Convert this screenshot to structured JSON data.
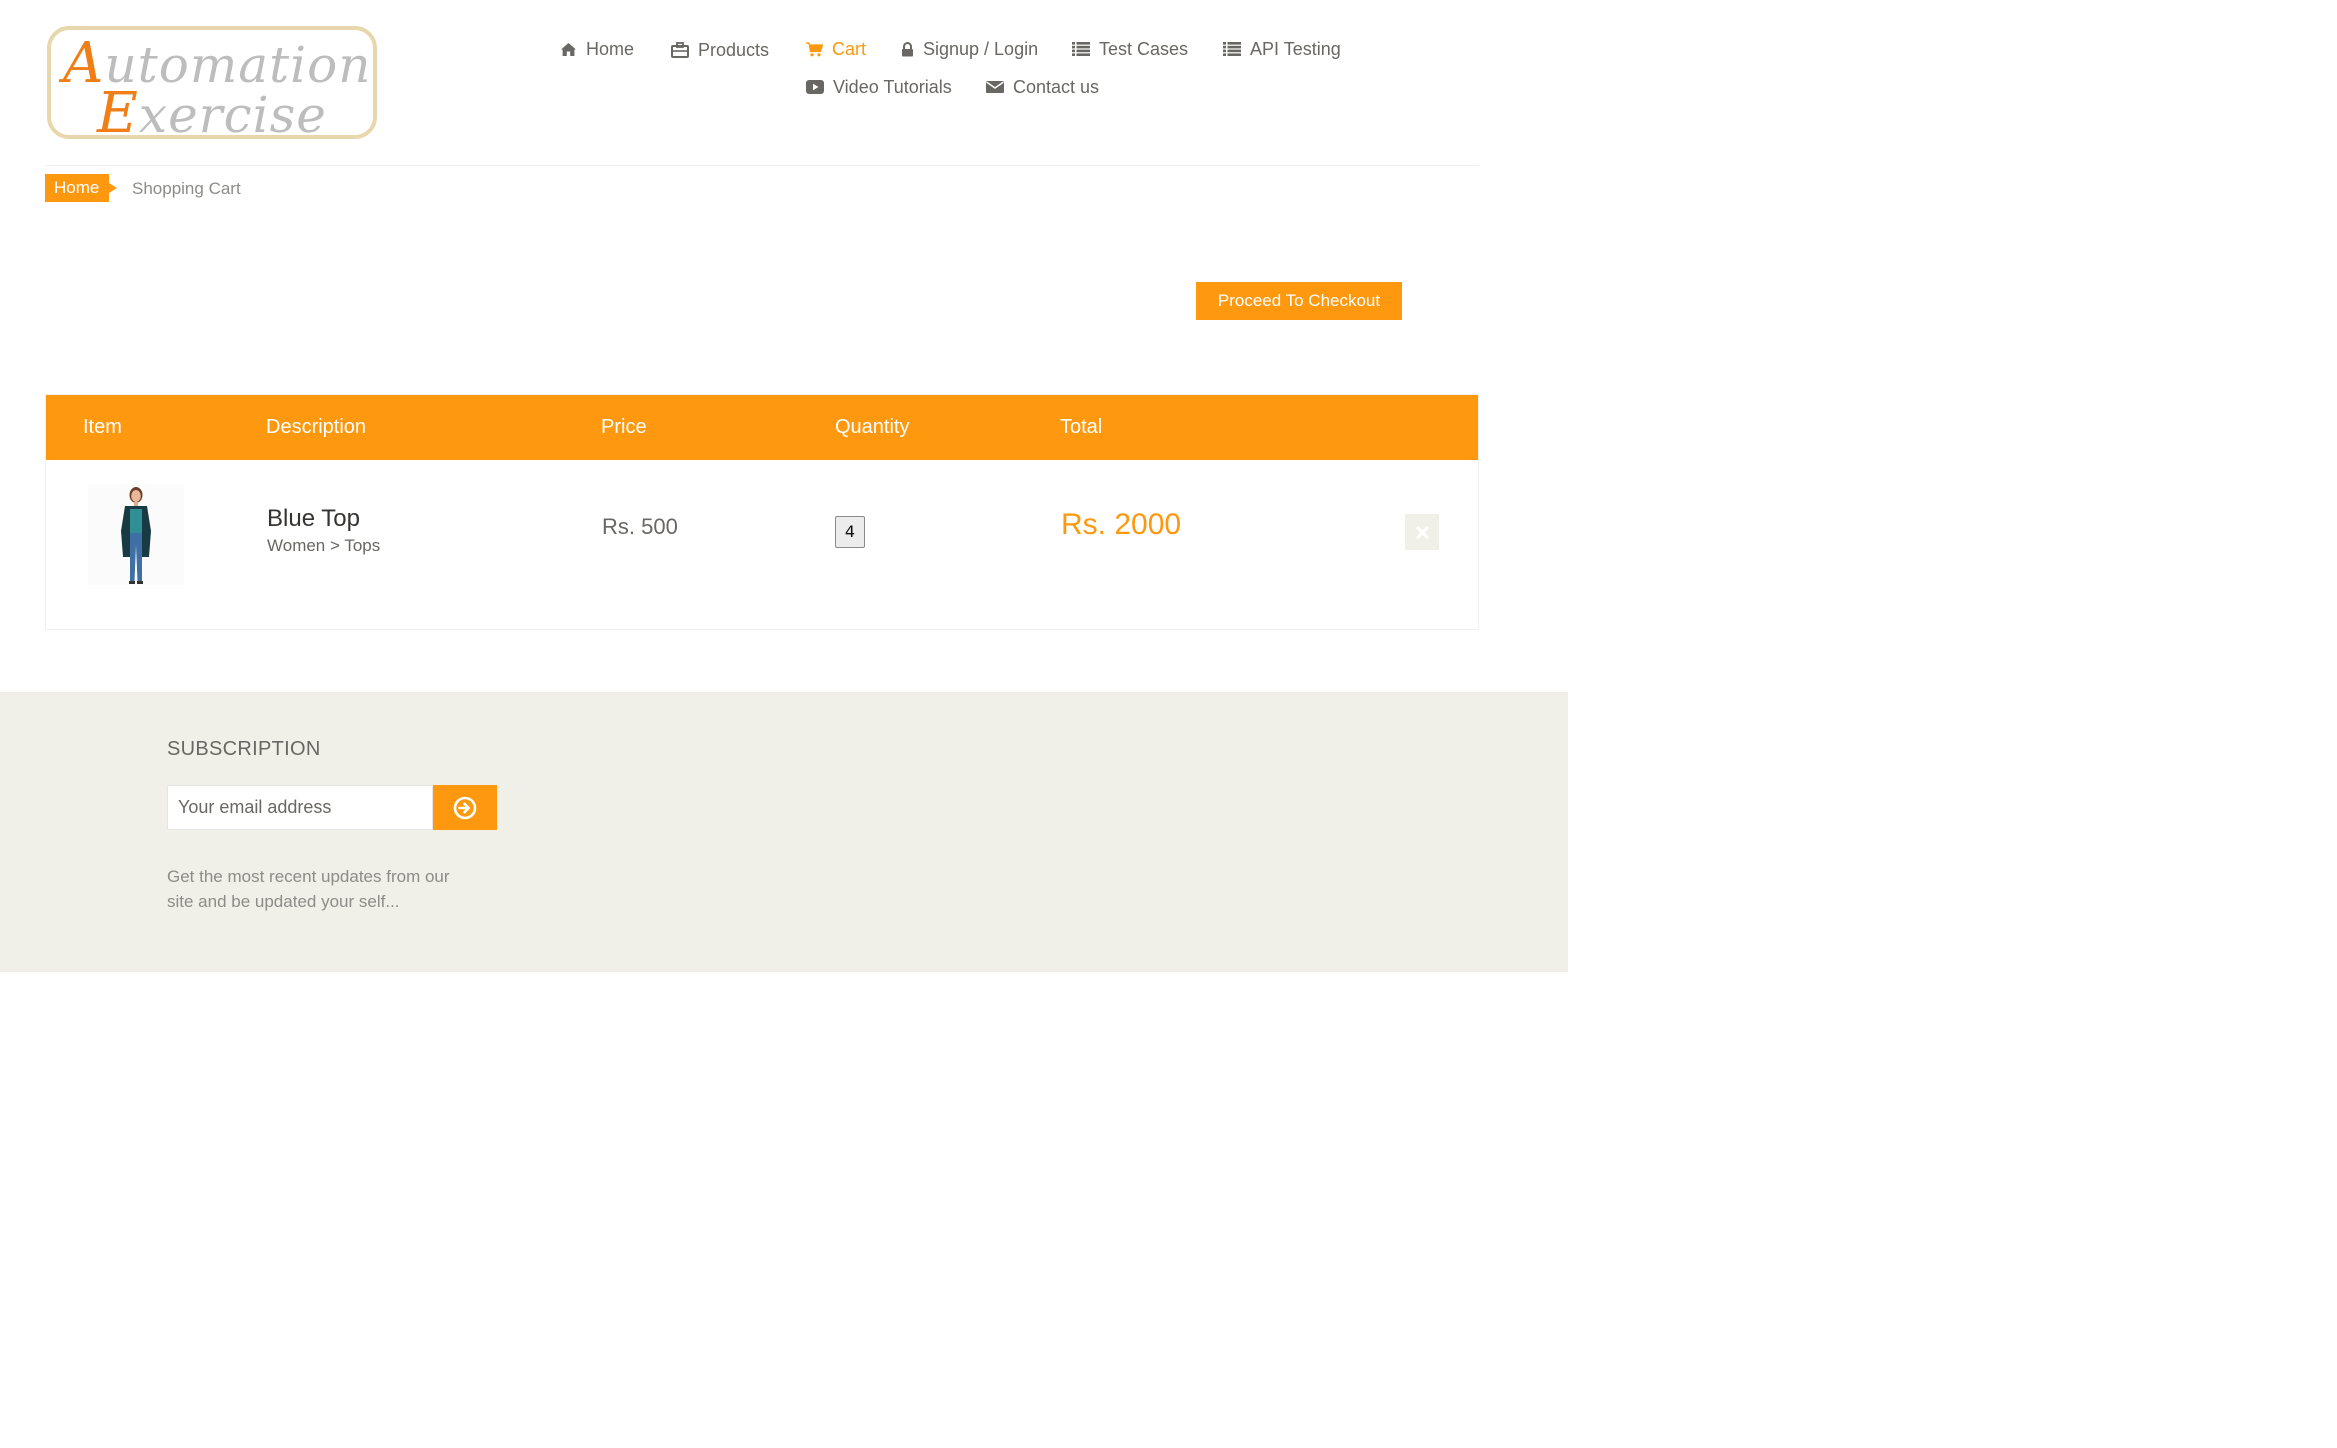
{
  "logo": {
    "line1_cap": "A",
    "line1_rest": "utomation",
    "line2_cap": "E",
    "line2_rest": "xercise"
  },
  "nav": {
    "home": "Home",
    "products": "Products",
    "cart": "Cart",
    "signup_login": "Signup / Login",
    "test_cases": "Test Cases",
    "api_testing": "API Testing",
    "video_tutorials": "Video Tutorials",
    "contact_us": "Contact us",
    "active_item": "Cart"
  },
  "breadcrumb": {
    "home": "Home",
    "current": "Shopping Cart"
  },
  "checkout_button": "Proceed To Checkout",
  "cart": {
    "headers": {
      "item": "Item",
      "description": "Description",
      "price": "Price",
      "quantity": "Quantity",
      "total": "Total"
    },
    "rows": [
      {
        "name": "Blue Top",
        "category": "Women > Tops",
        "price": "Rs. 500",
        "quantity": "4",
        "total": "Rs. 2000"
      }
    ]
  },
  "subscription": {
    "title": "SUBSCRIPTION",
    "email_placeholder": "Your email address",
    "description": "Get the most recent updates from our site and be updated your self..."
  },
  "colors": {
    "accent": "#fe980f",
    "footer_bg": "#f0f0e9",
    "text": "#696763",
    "logo_border": "#e8d6ad"
  },
  "icons": {
    "home": "home-icon",
    "products": "briefcase-icon",
    "cart": "shopping-cart-icon",
    "login": "lock-icon",
    "test_cases": "list-icon",
    "api": "list-icon",
    "video": "youtube-play-icon",
    "contact": "envelope-icon",
    "delete": "times-icon",
    "subscribe": "arrow-circle-right-icon"
  }
}
